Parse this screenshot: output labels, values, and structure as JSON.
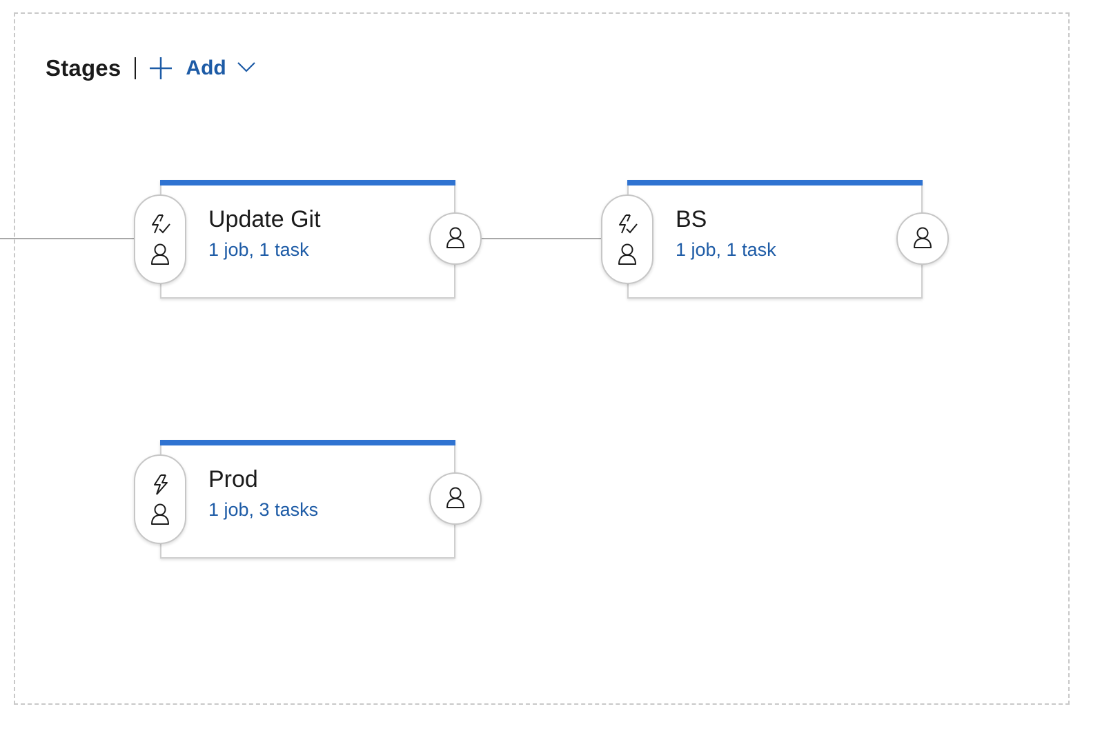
{
  "toolbar": {
    "title": "Stages",
    "add_label": "Add",
    "plus_icon": "plus-icon",
    "chevron_icon": "chevron-down-icon"
  },
  "stages": [
    {
      "name": "Update Git",
      "summary": "1 job, 1 task",
      "trigger_icon": "trigger-enabled-icon",
      "approval_icon": "person-icon",
      "post_icon": "person-icon"
    },
    {
      "name": "BS",
      "summary": "1 job, 1 task",
      "trigger_icon": "trigger-enabled-icon",
      "approval_icon": "person-icon",
      "post_icon": "person-icon"
    },
    {
      "name": "Prod",
      "summary": "1 job, 3 tasks",
      "trigger_icon": "trigger-manual-icon",
      "approval_icon": "person-icon",
      "post_icon": "person-icon"
    }
  ],
  "colors": {
    "accent": "#2f73d1",
    "link": "#1d5ba6",
    "text": "#1b1b1b",
    "connector": "#a8a8a8",
    "border": "#cfcfcf"
  }
}
